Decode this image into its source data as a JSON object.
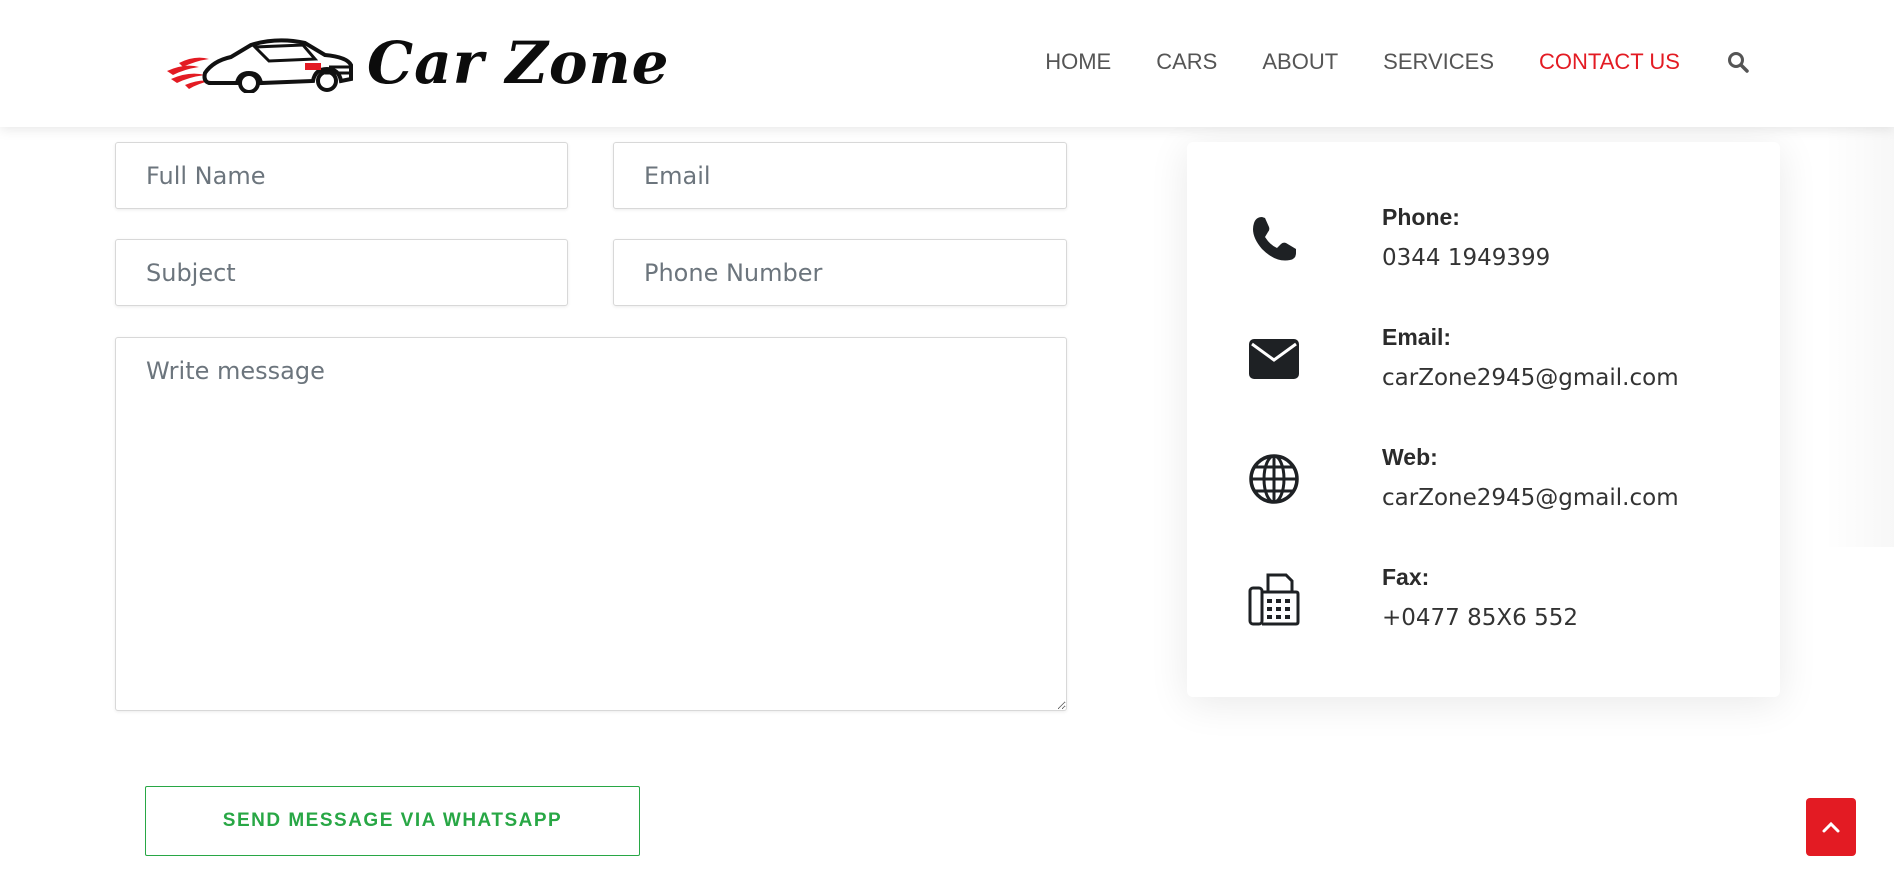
{
  "brand": {
    "name": "Car Zone",
    "accent_color": "#e31b23"
  },
  "nav": {
    "items": [
      {
        "label": "HOME"
      },
      {
        "label": "CARS"
      },
      {
        "label": "ABOUT"
      },
      {
        "label": "SERVICES"
      },
      {
        "label": "CONTACT US",
        "active": true
      }
    ],
    "search_icon": "search-icon"
  },
  "form": {
    "full_name_placeholder": "Full Name",
    "email_placeholder": "Email",
    "subject_placeholder": "Subject",
    "phone_placeholder": "Phone Number",
    "message_placeholder": "Write message",
    "submit_label": "SEND MESSAGE VIA WHATSAPP",
    "submit_color": "#28a745"
  },
  "contact": {
    "phone": {
      "label": "Phone:",
      "value": "0344 1949399",
      "icon": "phone-icon"
    },
    "email": {
      "label": "Email:",
      "value": "carZone2945@gmail.com",
      "icon": "envelope-icon"
    },
    "web": {
      "label": "Web:",
      "value": "carZone2945@gmail.com",
      "icon": "globe-icon"
    },
    "fax": {
      "label": "Fax:",
      "value": "+0477 85X6 552",
      "icon": "fax-icon"
    }
  },
  "back_to_top_icon": "chevron-up-icon"
}
